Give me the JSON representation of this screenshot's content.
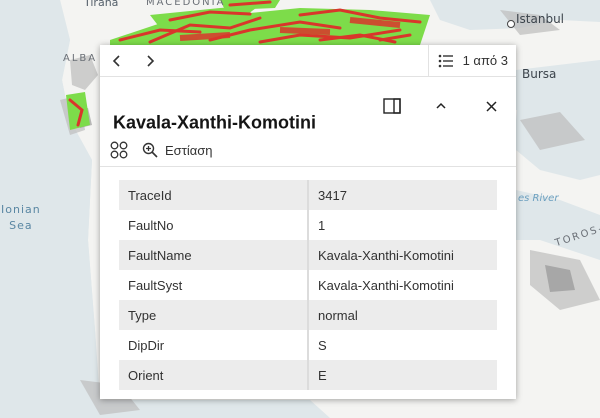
{
  "map": {
    "labels": {
      "tirana": "Tirana",
      "macedonia": "MACEDONIA",
      "alba": "ALBA",
      "istanbul": "Istanbul",
      "bursa": "Bursa",
      "ionian_sea": "Ionian\nSea",
      "river": "es River",
      "toros": "TOROS-D"
    },
    "colors": {
      "land": "#f4f4f2",
      "sea": "#dfe7ea",
      "fault": "#d9362b",
      "zone": "#7ddc4a"
    }
  },
  "popup": {
    "feature_count": "1 από 3",
    "title": "Kavala-Xanthi-Komotini",
    "zoom_label": "Εστίαση",
    "attributes": [
      {
        "key": "TraceId",
        "value": "3417"
      },
      {
        "key": "FaultNo",
        "value": "1"
      },
      {
        "key": "FaultName",
        "value": "Kavala-Xanthi-Komotini"
      },
      {
        "key": "FaultSyst",
        "value": "Kavala-Xanthi-Komotini"
      },
      {
        "key": "Type",
        "value": "normal"
      },
      {
        "key": "DipDir",
        "value": "S"
      },
      {
        "key": "Orient",
        "value": "E"
      }
    ]
  }
}
